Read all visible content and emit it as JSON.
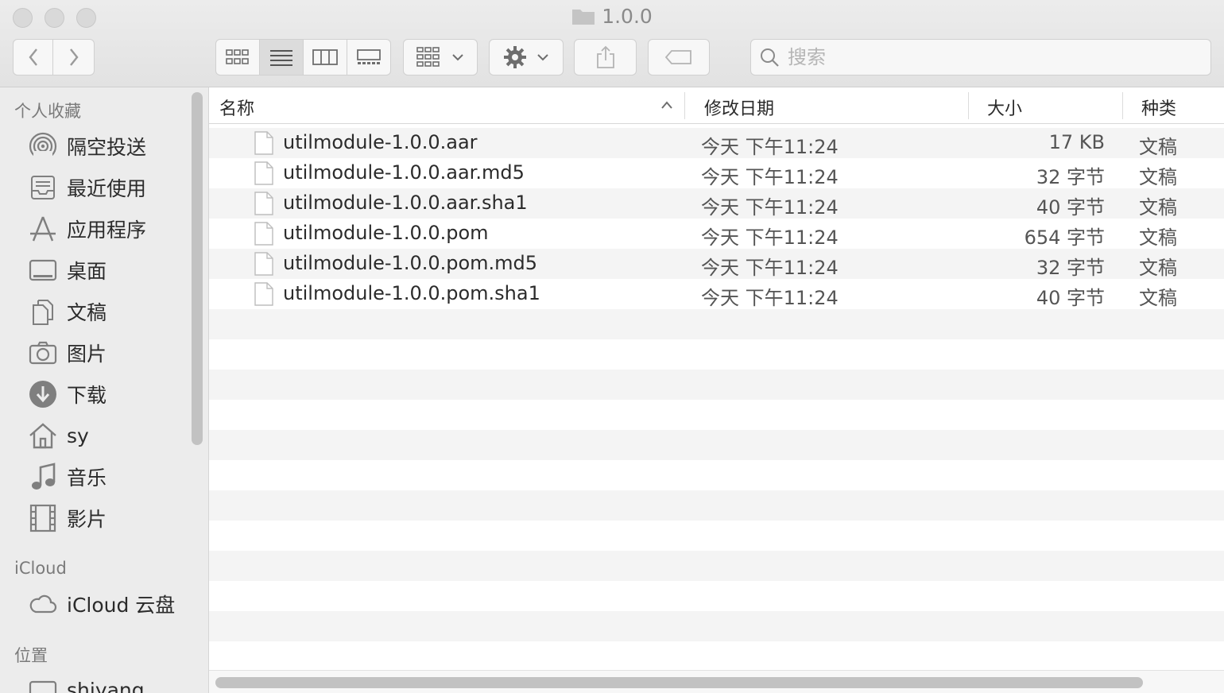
{
  "window": {
    "title": "1.0.0"
  },
  "toolbar": {
    "back_icon": "chevron-left-icon",
    "forward_icon": "chevron-right-icon",
    "view_modes": [
      "icon-view",
      "list-view",
      "column-view",
      "gallery-view"
    ],
    "active_view": "list-view",
    "search_placeholder": "搜索"
  },
  "sidebar": {
    "favorites_header": "个人收藏",
    "favorites": [
      {
        "label": "隔空投送",
        "icon": "airdrop-icon"
      },
      {
        "label": "最近使用",
        "icon": "recents-icon"
      },
      {
        "label": "应用程序",
        "icon": "applications-icon"
      },
      {
        "label": "桌面",
        "icon": "desktop-icon"
      },
      {
        "label": "文稿",
        "icon": "documents-icon"
      },
      {
        "label": "图片",
        "icon": "camera-icon"
      },
      {
        "label": "下载",
        "icon": "download-icon"
      },
      {
        "label": "sy",
        "icon": "home-icon"
      },
      {
        "label": "音乐",
        "icon": "music-icon"
      },
      {
        "label": "影片",
        "icon": "film-icon"
      }
    ],
    "icloud_header": "iCloud",
    "icloud": [
      {
        "label": "iCloud 云盘",
        "icon": "cloud-icon"
      }
    ],
    "locations_header": "位置",
    "locations": [
      {
        "label": "shiyang",
        "icon": "disk-icon"
      }
    ]
  },
  "columns": {
    "name": "名称",
    "date": "修改日期",
    "size": "大小",
    "kind": "种类"
  },
  "files": [
    {
      "name": "utilmodule-1.0.0.aar",
      "date": "今天 下午11:24",
      "size": "17 KB",
      "kind": "文稿"
    },
    {
      "name": "utilmodule-1.0.0.aar.md5",
      "date": "今天 下午11:24",
      "size": "32 字节",
      "kind": "文稿"
    },
    {
      "name": "utilmodule-1.0.0.aar.sha1",
      "date": "今天 下午11:24",
      "size": "40 字节",
      "kind": "文稿"
    },
    {
      "name": "utilmodule-1.0.0.pom",
      "date": "今天 下午11:24",
      "size": "654 字节",
      "kind": "文稿"
    },
    {
      "name": "utilmodule-1.0.0.pom.md5",
      "date": "今天 下午11:24",
      "size": "32 字节",
      "kind": "文稿"
    },
    {
      "name": "utilmodule-1.0.0.pom.sha1",
      "date": "今天 下午11:24",
      "size": "40 字节",
      "kind": "文稿"
    }
  ],
  "colors": {
    "sidebar_bg": "#ececec",
    "stripe": "#f4f4f4",
    "icon_gray": "#7f7f7f"
  }
}
